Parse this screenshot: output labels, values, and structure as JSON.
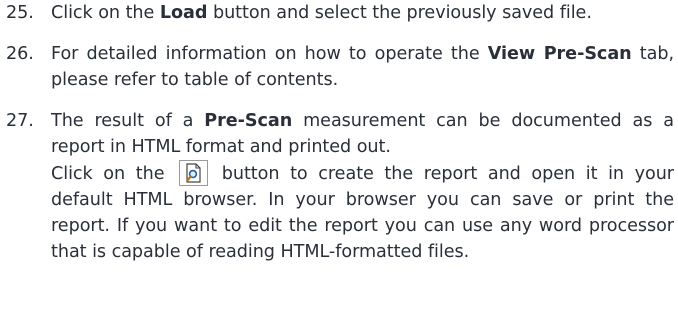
{
  "steps": [
    {
      "number": "25.",
      "t1": "Click on the ",
      "b1": "Load",
      "t2": " button and select the previously saved file."
    },
    {
      "number": "26.",
      "t1": "For detailed information on how to operate the ",
      "b1": "View Pre-Scan",
      "t2": " tab, please refer to table of contents."
    },
    {
      "number": "27.",
      "t1": "The result of a ",
      "b1": "Pre-Scan",
      "t2": " measurement can be documented as a report in HTML format and printed out.",
      "t3": "Click on the ",
      "icon": "report-preview-icon",
      "t4": " button to create the report and open it in your default HTML browser. In your browser you can save or print the report. If you want to edit the report you can use any word processor that is capable of reading HTML-formatted files."
    }
  ]
}
